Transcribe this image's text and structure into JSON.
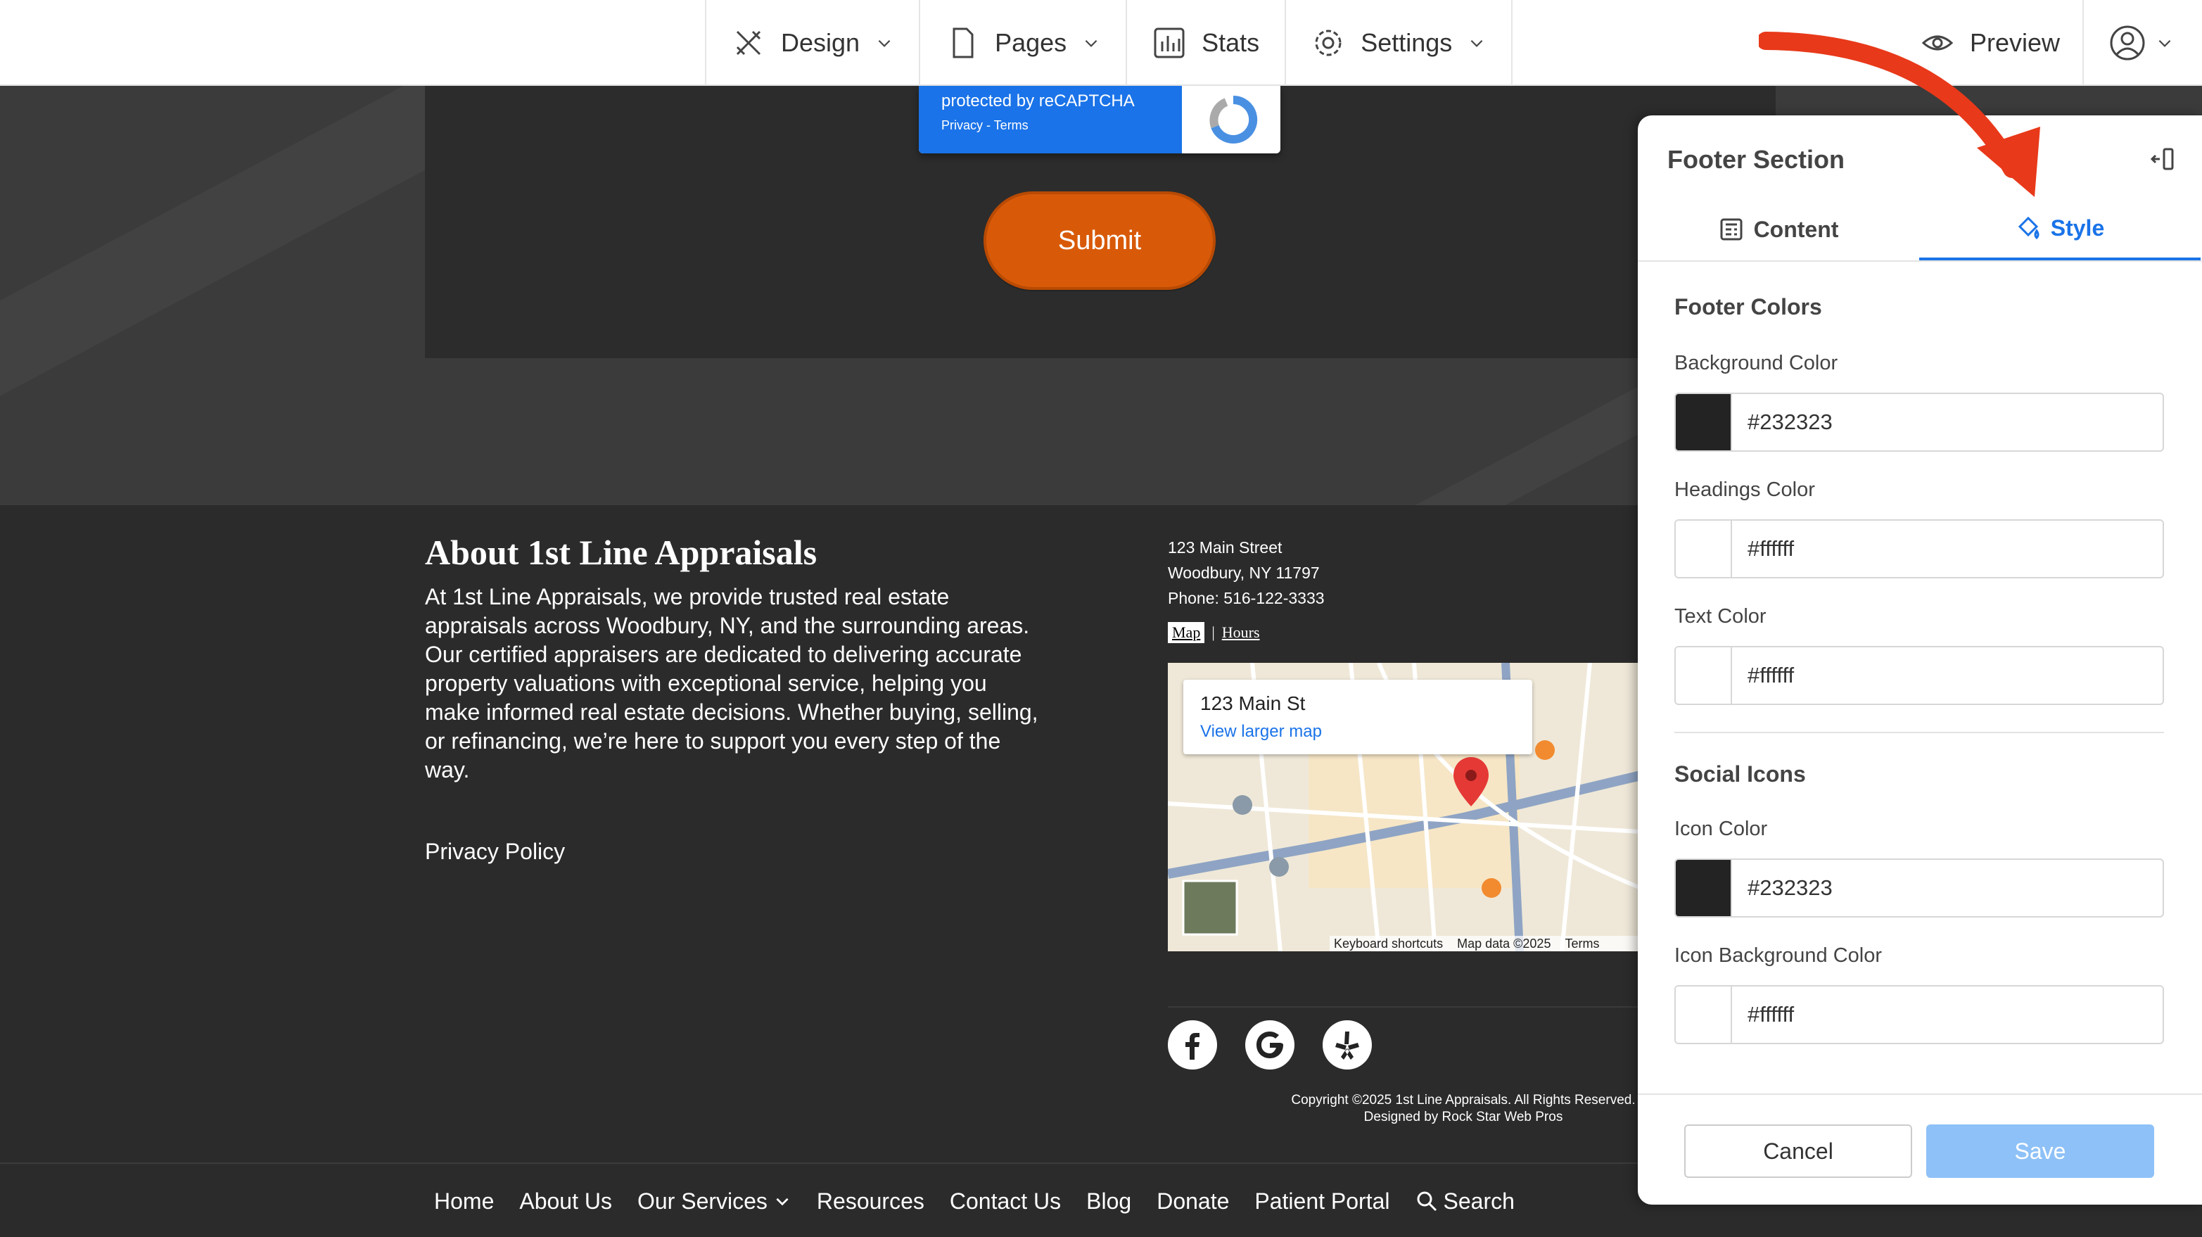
{
  "topbar": {
    "tabs": [
      {
        "label": "Design",
        "icon": "design-icon"
      },
      {
        "label": "Pages",
        "icon": "page-icon"
      },
      {
        "label": "Stats",
        "icon": "stats-icon"
      },
      {
        "label": "Settings",
        "icon": "gear-icon"
      }
    ],
    "preview_label": "Preview"
  },
  "form": {
    "recaptcha_text": "protected by reCAPTCHA",
    "recaptcha_links": "Privacy - Terms",
    "submit_label": "Submit"
  },
  "footer": {
    "about_title": "About 1st Line Appraisals",
    "about_text": "At 1st Line Appraisals, we provide trusted real estate appraisals across Woodbury, NY, and the surrounding areas. Our certified appraisers are dedicated to delivering accurate property valuations with exceptional service, helping you make informed real estate decisions. Whether buying, selling, or refinancing, we’re here to support you every step of the way.",
    "privacy_label": "Privacy Policy",
    "address_line1": "123 Main Street",
    "address_line2": "Woodbury, NY 11797",
    "phone": "Phone: 516-122-3333",
    "map_tab": "Map",
    "hours_tab": "Hours",
    "map_card_name": "123 Main St",
    "map_card_link": "View larger map",
    "map_footer": [
      "Keyboard shortcuts",
      "Map data ©2025",
      "Terms"
    ],
    "copyright": "Copyright ©2025 1st Line Appraisals. All Rights Reserved.",
    "designed_by": "Designed by Rock Star Web Pros",
    "social": [
      "facebook-icon",
      "google-icon",
      "yelp-icon"
    ]
  },
  "bottom_nav": {
    "items": [
      "Home",
      "About Us",
      "Our Services",
      "Resources",
      "Contact Us",
      "Blog",
      "Donate",
      "Patient Portal",
      "Search"
    ]
  },
  "panel": {
    "title": "Footer Section",
    "tabs": {
      "content": "Content",
      "style": "Style"
    },
    "footer_colors_heading": "Footer Colors",
    "fields": [
      {
        "label": "Background Color",
        "value": "#232323",
        "swatch": "#232323"
      },
      {
        "label": "Headings Color",
        "value": "#ffffff",
        "swatch": "#ffffff"
      },
      {
        "label": "Text Color",
        "value": "#ffffff",
        "swatch": "#ffffff"
      }
    ],
    "social_heading": "Social Icons",
    "social_fields": [
      {
        "label": "Icon Color",
        "value": "#232323",
        "swatch": "#232323"
      },
      {
        "label": "Icon Background Color",
        "value": "#ffffff",
        "swatch": "#ffffff"
      }
    ],
    "cancel_label": "Cancel",
    "save_label": "Save"
  },
  "colors": {
    "accent": "#1a73e8",
    "submit": "#d85a08",
    "arrow": "#e8391a"
  }
}
